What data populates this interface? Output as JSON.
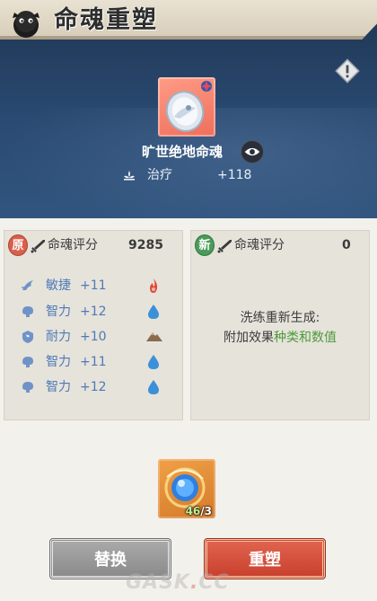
{
  "header": {
    "title": "命魂重塑"
  },
  "soul": {
    "name": "旷世绝地命魂",
    "stat": {
      "icon": "lotus-heal-icon",
      "label": "治疗",
      "value": "+118"
    }
  },
  "original_panel": {
    "badge": "原",
    "label": "命魂评分",
    "score": "9285",
    "attributes": [
      {
        "icon": "agility-icon",
        "name": "敏捷",
        "value": "+11",
        "element": "fire-icon",
        "element_color": "#e0493a"
      },
      {
        "icon": "intellect-icon",
        "name": "智力",
        "value": "+12",
        "element": "water-drop-icon",
        "element_color": "#3c8fd8"
      },
      {
        "icon": "stamina-icon",
        "name": "耐力",
        "value": "+10",
        "element": "mountain-icon",
        "element_color": "#8a6b4e"
      },
      {
        "icon": "intellect-icon",
        "name": "智力",
        "value": "+11",
        "element": "water-drop-icon",
        "element_color": "#3c8fd8"
      },
      {
        "icon": "intellect-icon",
        "name": "智力",
        "value": "+12",
        "element": "water-drop-icon",
        "element_color": "#3c8fd8"
      }
    ]
  },
  "new_panel": {
    "badge": "新",
    "label": "命魂评分",
    "score": "0",
    "message_line1": "洗练重新生成:",
    "message_line2_prefix": "附加效果",
    "message_line2_highlight": "种类和数值"
  },
  "material": {
    "owned": "46",
    "required": "/3"
  },
  "buttons": {
    "replace": "替换",
    "remake": "重塑"
  },
  "watermark": {
    "left": "GASK",
    "dot": ".",
    "right": "CC"
  },
  "colors": {
    "attribute_text": "#4e79b8",
    "highlight_green": "#4c9a3a",
    "remake_red": "#d24e3a"
  }
}
